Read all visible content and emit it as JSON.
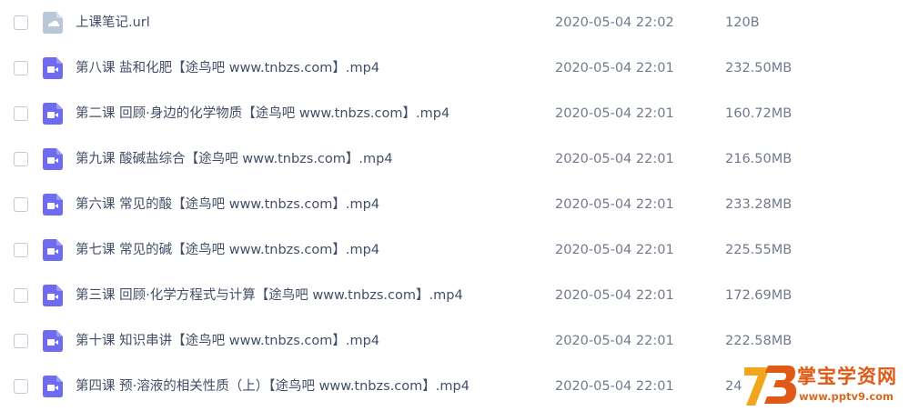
{
  "colors": {
    "video_icon": "#6e6bf0",
    "url_icon": "#b9c7d9",
    "watermark": "#e05a17"
  },
  "files": [
    {
      "name": "上课笔记.url",
      "date": "2020-05-04 22:02",
      "size": "120B",
      "icon": "link-file-icon"
    },
    {
      "name": "第八课 盐和化肥【途鸟吧 www.tnbzs.com】.mp4",
      "date": "2020-05-04 22:01",
      "size": "232.50MB",
      "icon": "video-file-icon"
    },
    {
      "name": "第二课 回顾·身边的化学物质【途鸟吧 www.tnbzs.com】.mp4",
      "date": "2020-05-04 22:01",
      "size": "160.72MB",
      "icon": "video-file-icon"
    },
    {
      "name": "第九课 酸碱盐综合【途鸟吧 www.tnbzs.com】.mp4",
      "date": "2020-05-04 22:01",
      "size": "216.50MB",
      "icon": "video-file-icon"
    },
    {
      "name": "第六课 常见的酸【途鸟吧 www.tnbzs.com】.mp4",
      "date": "2020-05-04 22:01",
      "size": "233.28MB",
      "icon": "video-file-icon"
    },
    {
      "name": "第七课 常见的碱【途鸟吧 www.tnbzs.com】.mp4",
      "date": "2020-05-04 22:01",
      "size": "225.55MB",
      "icon": "video-file-icon"
    },
    {
      "name": "第三课 回顾·化学方程式与计算【途鸟吧 www.tnbzs.com】.mp4",
      "date": "2020-05-04 22:01",
      "size": "172.69MB",
      "icon": "video-file-icon"
    },
    {
      "name": "第十课 知识串讲【途鸟吧 www.tnbzs.com】.mp4",
      "date": "2020-05-04 22:01",
      "size": "222.58MB",
      "icon": "video-file-icon"
    },
    {
      "name": "第四课 预·溶液的相关性质（上）【途鸟吧 www.tnbzs.com】.mp4",
      "date": "2020-05-04 22:01",
      "size": "24",
      "icon": "video-file-icon"
    }
  ],
  "watermark": {
    "logo": "73",
    "text": "掌宝学资网",
    "url": "www.pptv9.com"
  }
}
